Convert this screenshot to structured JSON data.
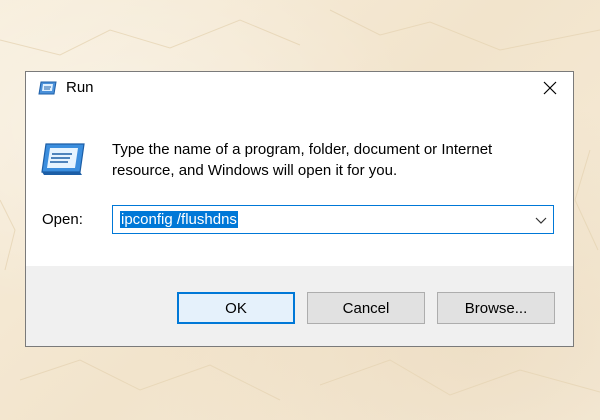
{
  "window": {
    "title": "Run",
    "title_icon": "run-icon",
    "close_icon": "close-icon"
  },
  "content": {
    "prompt_text": "Type the name of a program, folder, document or Internet resource, and Windows will open it for you.",
    "big_icon": "run-icon",
    "open_label": "Open:",
    "open_value": "ipconfig /flushdns",
    "dropdown_icon": "chevron-down-icon"
  },
  "buttons": {
    "ok_label": "OK",
    "cancel_label": "Cancel",
    "browse_label": "Browse..."
  },
  "colors": {
    "accent": "#0078d7",
    "footer_bg": "#f0f0f0",
    "button_bg": "#e1e1e1",
    "page_bg": "#f5ead6"
  }
}
